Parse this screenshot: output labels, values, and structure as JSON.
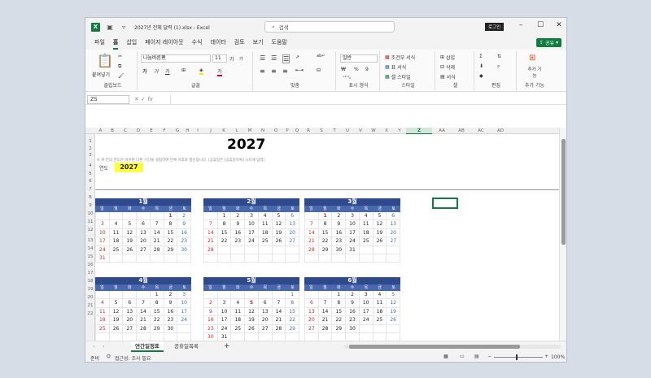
{
  "window": {
    "title": "2027년 전체 달력 (1).xlsx  -  Excel",
    "search_placeholder": "검색",
    "login": "로그인",
    "share": "공유"
  },
  "menu_tabs": [
    "파일",
    "홈",
    "삽입",
    "페이지 레이아웃",
    "수식",
    "데이터",
    "검토",
    "보기",
    "도움말"
  ],
  "ribbon": {
    "clipboard": {
      "paste": "붙여넣기",
      "label": "클립보드"
    },
    "font": {
      "name": "나눔바른펜",
      "size": "11",
      "grow": "가",
      "shrink": "가",
      "bold": "가",
      "italic": "가",
      "underline": "가",
      "fill_glyph": "가",
      "label": "글꼴"
    },
    "alignment": {
      "label": "맞춤"
    },
    "number": {
      "format": "일반",
      "label": "표시 형식"
    },
    "styles": {
      "conditional": "조건부 서식",
      "table": "표 서식",
      "cell": "셀 스타일",
      "label": "스타일"
    },
    "cells": {
      "insert": "삽입",
      "delete": "삭제",
      "format": "서식",
      "label": "셀"
    },
    "editing": {
      "label": "편집"
    },
    "addins": {
      "item": "추가 기능",
      "label": "추가 기능"
    }
  },
  "formula_bar": {
    "namebox": "Z5",
    "fx": "fx",
    "value": ""
  },
  "columns": [
    "A",
    "B",
    "C",
    "D",
    "E",
    "F",
    "G",
    "H",
    "I",
    "J",
    "K",
    "L",
    "M",
    "N",
    "O",
    "P",
    "Q",
    "R",
    "S",
    "T",
    "U",
    "V",
    "W",
    "X",
    "Y",
    "Z",
    "AA",
    "AB",
    "AC",
    "AD"
  ],
  "selected_column": "Z",
  "rows": [
    "1",
    "2",
    "3",
    "4",
    "5",
    "6",
    "7",
    "8",
    "9",
    "10",
    "11",
    "12",
    "13",
    "14",
    "15",
    "16",
    "17",
    "18",
    "19",
    "20",
    "21",
    "22"
  ],
  "sheet": {
    "year_title": "2027",
    "note": "※ 위 칸의 연도만 바꾸면 다른 기간을 설정하여 전체 이후로 갱신됩니다. (공휴일은 [공휴일목록] 시트에 입력)",
    "year_label": "연도",
    "year_value": "2027"
  },
  "weekday_headers": [
    "일",
    "월",
    "화",
    "수",
    "목",
    "금",
    "토"
  ],
  "calendars": [
    {
      "month": "1월",
      "weeks": [
        [
          "",
          "",
          "",
          "",
          "",
          "1",
          "2"
        ],
        [
          "3",
          "4",
          "5",
          "6",
          "7",
          "8",
          "9"
        ],
        [
          "10",
          "11",
          "12",
          "13",
          "14",
          "15",
          "16"
        ],
        [
          "17",
          "18",
          "19",
          "20",
          "21",
          "22",
          "23"
        ],
        [
          "24",
          "25",
          "26",
          "27",
          "28",
          "29",
          "30"
        ],
        [
          "31",
          "",
          "",
          "",
          "",
          "",
          ""
        ]
      ],
      "holidays": [
        "1"
      ]
    },
    {
      "month": "2월",
      "weeks": [
        [
          "",
          "1",
          "2",
          "3",
          "4",
          "5",
          "6"
        ],
        [
          "7",
          "8",
          "9",
          "10",
          "11",
          "12",
          "13"
        ],
        [
          "14",
          "15",
          "16",
          "17",
          "18",
          "19",
          "20"
        ],
        [
          "21",
          "22",
          "23",
          "24",
          "25",
          "26",
          "27"
        ],
        [
          "28",
          "",
          "",
          "",
          "",
          "",
          ""
        ],
        [
          "",
          "",
          "",
          "",
          "",
          "",
          ""
        ]
      ],
      "holidays": []
    },
    {
      "month": "3월",
      "weeks": [
        [
          "",
          "1",
          "2",
          "3",
          "4",
          "5",
          "6"
        ],
        [
          "7",
          "8",
          "9",
          "10",
          "11",
          "12",
          "13"
        ],
        [
          "14",
          "15",
          "16",
          "17",
          "18",
          "19",
          "20"
        ],
        [
          "21",
          "22",
          "23",
          "24",
          "25",
          "26",
          "27"
        ],
        [
          "28",
          "29",
          "30",
          "31",
          "",
          "",
          ""
        ],
        [
          "",
          "",
          "",
          "",
          "",
          "",
          ""
        ]
      ],
      "holidays": [
        "1"
      ]
    },
    {
      "month": "4월",
      "weeks": [
        [
          "",
          "",
          "",
          "",
          "1",
          "2",
          "3"
        ],
        [
          "4",
          "5",
          "6",
          "7",
          "8",
          "9",
          "10"
        ],
        [
          "11",
          "12",
          "13",
          "14",
          "15",
          "16",
          "17"
        ],
        [
          "18",
          "19",
          "20",
          "21",
          "22",
          "23",
          "24"
        ],
        [
          "25",
          "26",
          "27",
          "28",
          "29",
          "30",
          ""
        ],
        [
          "",
          "",
          "",
          "",
          "",
          "",
          ""
        ]
      ],
      "holidays": []
    },
    {
      "month": "5월",
      "weeks": [
        [
          "",
          "",
          "",
          "",
          "",
          "",
          "1"
        ],
        [
          "2",
          "3",
          "4",
          "5",
          "6",
          "7",
          "8"
        ],
        [
          "9",
          "10",
          "11",
          "12",
          "13",
          "14",
          "15"
        ],
        [
          "16",
          "17",
          "18",
          "19",
          "20",
          "21",
          "22"
        ],
        [
          "23",
          "24",
          "25",
          "26",
          "27",
          "28",
          "29"
        ],
        [
          "30",
          "31",
          "",
          "",
          "",
          "",
          ""
        ]
      ],
      "holidays": [
        "5"
      ]
    },
    {
      "month": "6월",
      "weeks": [
        [
          "",
          "",
          "1",
          "2",
          "3",
          "4",
          "5"
        ],
        [
          "6",
          "7",
          "8",
          "9",
          "10",
          "11",
          "12"
        ],
        [
          "13",
          "14",
          "15",
          "16",
          "17",
          "18",
          "19"
        ],
        [
          "20",
          "21",
          "22",
          "23",
          "24",
          "25",
          "26"
        ],
        [
          "27",
          "28",
          "29",
          "30",
          "",
          "",
          ""
        ],
        [
          "",
          "",
          "",
          "",
          "",
          "",
          ""
        ]
      ],
      "holidays": [
        "6"
      ]
    }
  ],
  "sheet_tabs": [
    "연간일정표",
    "공휴일목록"
  ],
  "active_sheet": "연간일정표",
  "status": {
    "ready": "준비",
    "accessibility": "접근성: 조사 필요",
    "zoom": "100%"
  },
  "colors": {
    "excel_green": "#107c41",
    "month_header": "#2e4a8c",
    "weekday_header": "#4a68ad",
    "sunday": "#c62828",
    "saturday": "#3b6fb6",
    "year_highlight": "#ffff3b"
  }
}
